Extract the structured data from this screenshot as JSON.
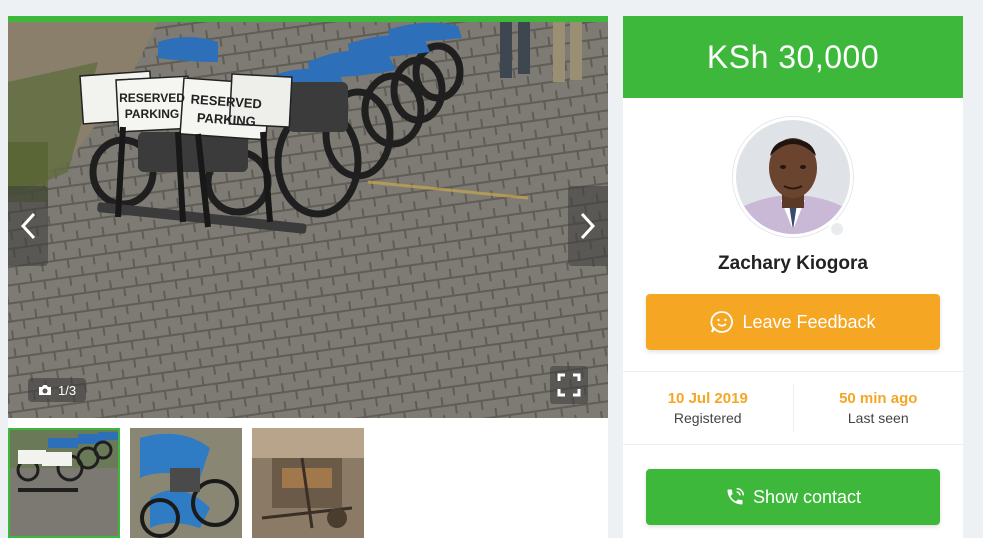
{
  "gallery": {
    "counter_text": "1/3",
    "photo_count": 3,
    "active_index": 0,
    "photo_sign_lines": [
      "RESERVED",
      "PARKING"
    ],
    "icons": {
      "prev": "chevron-left-icon",
      "next": "chevron-right-icon",
      "camera": "camera-icon",
      "fullscreen": "fullscreen-icon"
    }
  },
  "seller": {
    "price": "KSh 30,000",
    "name": "Zachary Kiogora",
    "feedback_label": "Leave Feedback",
    "registered_value": "10 Jul 2019",
    "registered_label": "Registered",
    "last_seen_value": "50 min ago",
    "last_seen_label": "Last seen",
    "contact_label": "Show contact"
  },
  "colors": {
    "brand_green": "#3db83a",
    "accent_orange": "#f5a623",
    "background": "#edf1f4"
  }
}
